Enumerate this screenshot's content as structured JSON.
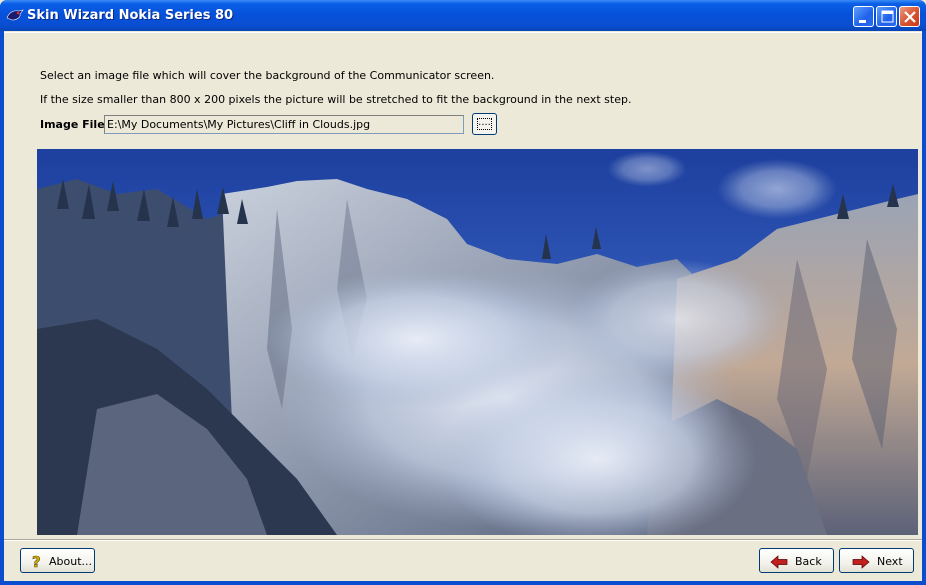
{
  "window": {
    "title": "Skin Wizard Nokia Series 80"
  },
  "content": {
    "instruction_line1": "Select an image file which will cover the background of the Communicator screen.",
    "instruction_line2": "If the size smaller than 800 x 200 pixels the picture will be stretched to fit the background in the next step.",
    "image_file_label": "Image File:",
    "image_file_value": "E:\\My Documents\\My Pictures\\Cliff in Clouds.jpg",
    "browse_label": "...."
  },
  "footer": {
    "about_label": "About...",
    "back_label": "Back",
    "next_label": "Next"
  },
  "colors": {
    "titlebar": "#0a5fe6",
    "face": "#ece9d8",
    "back_arrow": "#c0201e",
    "next_arrow": "#c0201e"
  },
  "icons": {
    "app": "nokia-skin-icon",
    "about": "question-mark-icon",
    "back": "arrow-left-icon",
    "next": "arrow-right-icon"
  }
}
